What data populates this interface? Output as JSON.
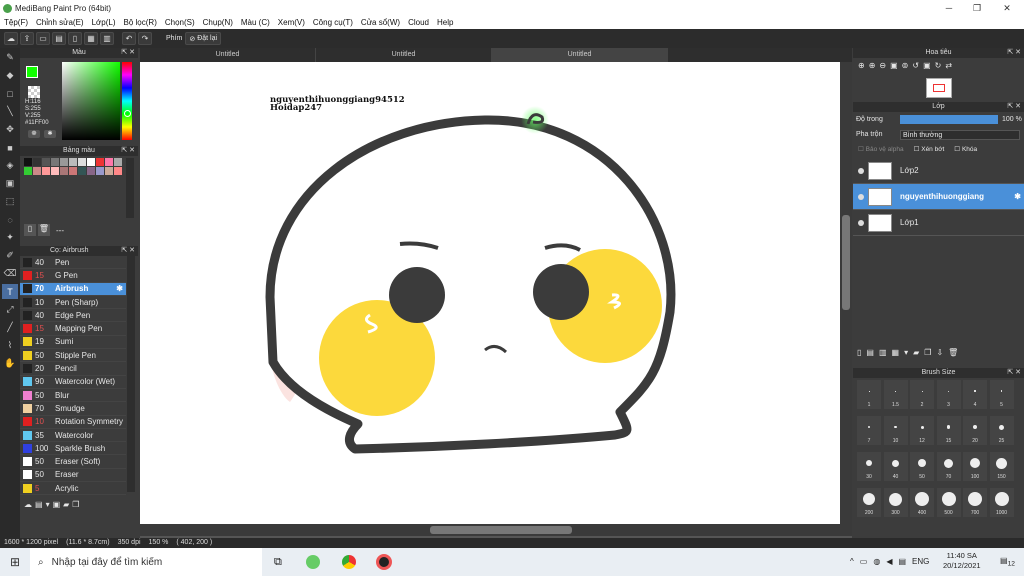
{
  "window": {
    "title": "MediBang Paint Pro (64bit)"
  },
  "menu": [
    "Tệp(F)",
    "Chỉnh sửa(E)",
    "Lớp(L)",
    "Bộ lọc(R)",
    "Chọn(S)",
    "Chụp(N)",
    "Màu (C)",
    "Xem(V)",
    "Công cụ(T)",
    "Cửa sổ(W)",
    "Cloud",
    "Help"
  ],
  "toolbar": {
    "key_label": "Phím",
    "reset_label": "Đặt lại"
  },
  "tabs": [
    "Untitled",
    "Untitled",
    "Untitled"
  ],
  "color_panel": {
    "title": "Màu",
    "h": "H:116",
    "s": "S:255",
    "v": "V:255",
    "hex": "#11FF00",
    "fg_color": "#11FF00"
  },
  "palette_panel": {
    "title": "Bảng màu",
    "dash": "---"
  },
  "brush_panel": {
    "title": "Cọ: Airbrush",
    "items": [
      {
        "num": "40",
        "name": "Pen",
        "color": "#222222"
      },
      {
        "num": "15",
        "name": "G Pen",
        "color": "#e02020"
      },
      {
        "num": "70",
        "name": "Airbrush",
        "color": "#222222"
      },
      {
        "num": "10",
        "name": "Pen (Sharp)",
        "color": "#222222"
      },
      {
        "num": "40",
        "name": "Edge Pen",
        "color": "#222222"
      },
      {
        "num": "15",
        "name": "Mapping Pen",
        "color": "#e02020"
      },
      {
        "num": "19",
        "name": "Sumi",
        "color": "#f0d020"
      },
      {
        "num": "50",
        "name": "Stipple Pen",
        "color": "#f0d020"
      },
      {
        "num": "20",
        "name": "Pencil",
        "color": "#222222"
      },
      {
        "num": "90",
        "name": "Watercolor (Wet)",
        "color": "#60c8f0"
      },
      {
        "num": "50",
        "name": "Blur",
        "color": "#f080d0"
      },
      {
        "num": "70",
        "name": "Smudge",
        "color": "#f0d0a0"
      },
      {
        "num": "10",
        "name": "Rotation Symmetry",
        "color": "#e02020"
      },
      {
        "num": "35",
        "name": "Watercolor",
        "color": "#60c8f0"
      },
      {
        "num": "100",
        "name": "Sparkle Brush",
        "color": "#3040e0"
      },
      {
        "num": "50",
        "name": "Eraser (Soft)",
        "color": "#ffffff"
      },
      {
        "num": "50",
        "name": "Eraser",
        "color": "#ffffff"
      },
      {
        "num": "5",
        "name": "Acrylic",
        "color": "#f0d020"
      }
    ]
  },
  "canvas": {
    "watermark_line1": "nguyenthihuonggiang94512",
    "watermark_line2": "Hoidap247"
  },
  "navigator": {
    "title": "Hoa tiêu"
  },
  "layers_panel": {
    "title": "Lớp",
    "opacity_label": "Độ trong",
    "opacity_value": "100 %",
    "blend_label": "Pha trộn",
    "blend_value": "Bình thường",
    "protect_alpha": "Bảo vệ alpha",
    "clipping": "Xén bớt",
    "lock": "Khóa",
    "items": [
      "Lớp2",
      "nguyenthihuonggiang",
      "Lớp1"
    ]
  },
  "brush_size": {
    "title": "Brush Size",
    "sizes": [
      "1",
      "1.5",
      "2",
      "3",
      "4",
      "5",
      "7",
      "10",
      "12",
      "15",
      "20",
      "25",
      "30",
      "40",
      "50",
      "70",
      "100",
      "150",
      "200",
      "300",
      "400",
      "500",
      "700",
      "1000"
    ]
  },
  "status": {
    "size": "1600 * 1200 pixel",
    "cm": "(11.6 * 8.7cm)",
    "dpi": "350 dpi",
    "zoom": "150 %",
    "coords": "( 402, 200 )"
  },
  "taskbar": {
    "search_placeholder": "Nhập tại đây để tìm kiếm",
    "lang": "ENG",
    "time": "11:40 SA",
    "date": "20/12/2021",
    "notif": "12"
  }
}
